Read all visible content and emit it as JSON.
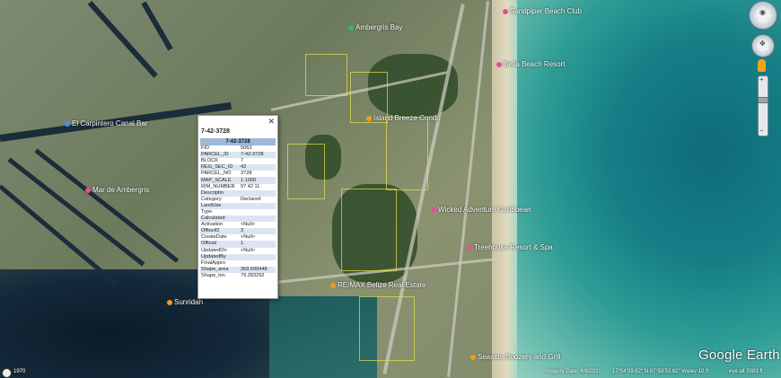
{
  "popup": {
    "title": "7-42-3728",
    "table_header": "7-42-3728",
    "rows": [
      {
        "key": "FID",
        "value": "5063"
      },
      {
        "key": "PARCEL_ID",
        "value": "7-42-3728"
      },
      {
        "key": "BLOCK",
        "value": "7"
      },
      {
        "key": "REG_SEC_ID",
        "value": "42"
      },
      {
        "key": "PARCEL_NO",
        "value": "3728"
      },
      {
        "key": "MAP_SCALE",
        "value": "1:1000"
      },
      {
        "key": "RIM_NUMBER",
        "value": "07 42 11"
      },
      {
        "key": "Descriptio",
        "value": ""
      },
      {
        "key": "Category",
        "value": "Declared"
      },
      {
        "key": "LandUse",
        "value": ""
      },
      {
        "key": "Type",
        "value": ""
      },
      {
        "key": "Calculated",
        "value": ""
      },
      {
        "key": "Activation",
        "value": "<Null>"
      },
      {
        "key": "OfficeID",
        "value": "3"
      },
      {
        "key": "CreateDate",
        "value": "<Null>"
      },
      {
        "key": "Official",
        "value": "1"
      },
      {
        "key": "UpdatedOn",
        "value": "<Null>"
      },
      {
        "key": "UpdatedBy",
        "value": ""
      },
      {
        "key": "FinalAppro",
        "value": ""
      },
      {
        "key": "Shape_area",
        "value": "369.699448"
      },
      {
        "key": "Shape_len",
        "value": "79.283292"
      }
    ],
    "close_glyph": "✕"
  },
  "places": [
    {
      "name": "Ambergris Bay",
      "pin": "green"
    },
    {
      "name": "Bella Beach Resort",
      "pin": "pink"
    },
    {
      "name": "Wicked Adventure Caribbean",
      "pin": "pink"
    },
    {
      "name": "Treehouse Resort & Spa",
      "pin": "pink"
    },
    {
      "name": "RE/MAX Belize Real Estate",
      "pin": "orange"
    },
    {
      "name": "Seaside Boozery and Grill",
      "pin": "orange"
    },
    {
      "name": "Mar de Ambergris",
      "pin": "pink"
    },
    {
      "name": "El Carpintero Canal Bar",
      "pin": "blue"
    },
    {
      "name": "Sunridah",
      "pin": "orange"
    },
    {
      "name": "Island Breeze Condo",
      "pin": "orange"
    },
    {
      "name": "Sandpiper Beach Club",
      "pin": "pink"
    }
  ],
  "statusbar": {
    "imagery_date": "Imagery Date: 4/8/2021",
    "coords": "17°54'09.62\" N  87°58'53.62\" W",
    "elev": "elev  10 ft",
    "eye_alt": "eye alt  5083 ft",
    "year": "1970"
  },
  "logo": "Google Earth",
  "nav": {
    "look_icon": "look-around-icon",
    "move_icon": "move-icon",
    "pegman_icon": "street-view-pegman-icon",
    "zoom_plus": "+",
    "zoom_minus": "−"
  }
}
